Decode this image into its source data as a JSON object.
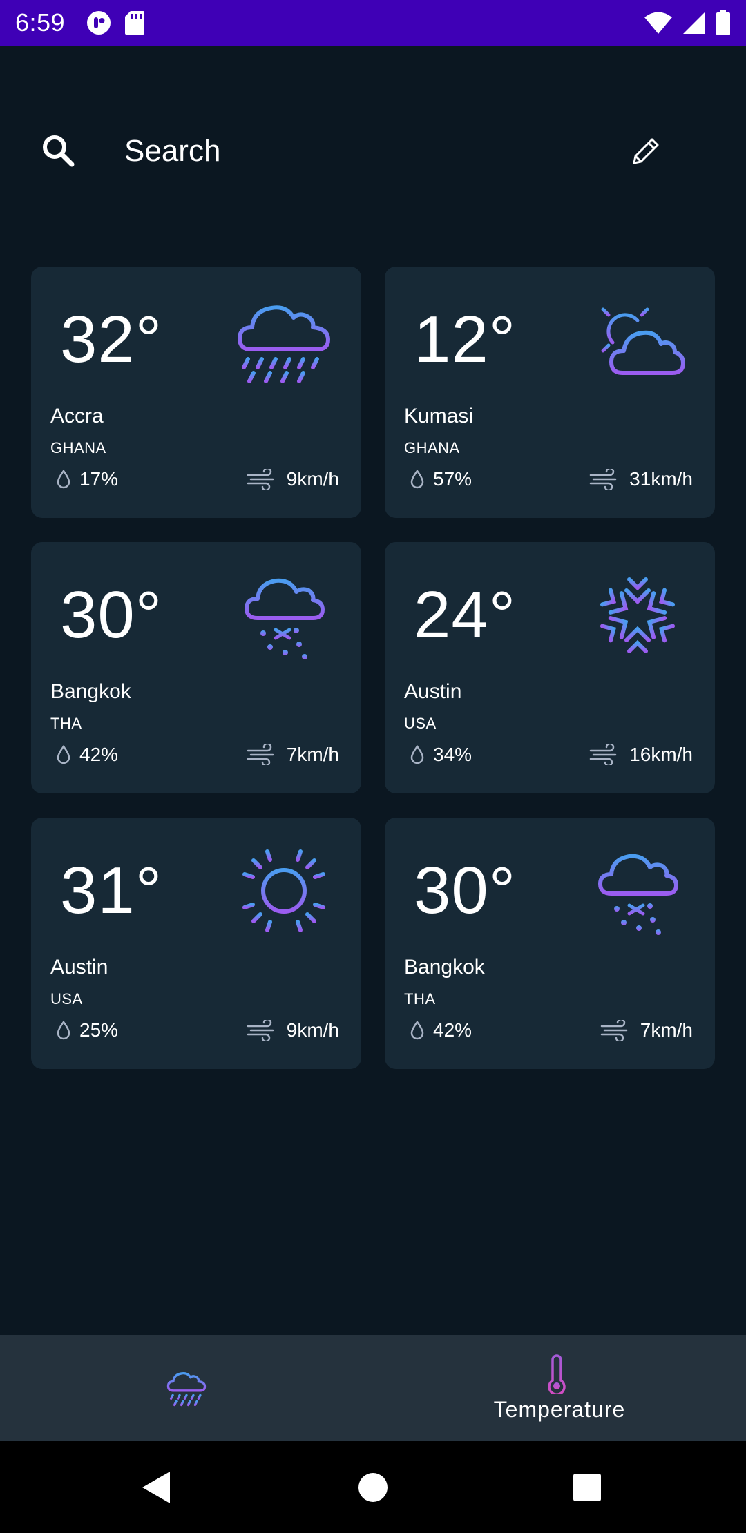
{
  "status_bar": {
    "time": "6:59",
    "left_icons": [
      "notification-app-icon",
      "sd-card-icon"
    ],
    "right_icons": [
      "wifi-icon",
      "signal-icon",
      "battery-icon"
    ],
    "background": "#3f00b6"
  },
  "search": {
    "placeholder": "Search",
    "value": ""
  },
  "cards": [
    {
      "temp": "32°",
      "city": "Accra",
      "country": "GHANA",
      "humidity": "17%",
      "wind": "9km/h",
      "icon": "rain-cloud-icon"
    },
    {
      "temp": "12°",
      "city": "Kumasi",
      "country": "GHANA",
      "humidity": "57%",
      "wind": "31km/h",
      "icon": "partly-cloudy-sun-icon"
    },
    {
      "temp": "30°",
      "city": "Bangkok",
      "country": "THA",
      "humidity": "42%",
      "wind": "7km/h",
      "icon": "snow-cloud-icon"
    },
    {
      "temp": "24°",
      "city": "Austin",
      "country": "USA",
      "humidity": "34%",
      "wind": "16km/h",
      "icon": "snowflake-icon"
    },
    {
      "temp": "31°",
      "city": "Austin",
      "country": "USA",
      "humidity": "25%",
      "wind": "9km/h",
      "icon": "sun-icon"
    },
    {
      "temp": "30°",
      "city": "Bangkok",
      "country": "THA",
      "humidity": "42%",
      "wind": "7km/h",
      "icon": "snow-cloud-icon"
    }
  ],
  "bottom_nav": {
    "items": [
      {
        "icon": "rain-cloud-icon",
        "label": ""
      },
      {
        "icon": "thermometer-icon",
        "label": "Temperature"
      }
    ]
  },
  "colors": {
    "background": "#0b1721",
    "card": "#172936",
    "bottom_nav": "#25323d",
    "gradient_start": "#4a9df0",
    "gradient_end": "#9b5cf0"
  }
}
